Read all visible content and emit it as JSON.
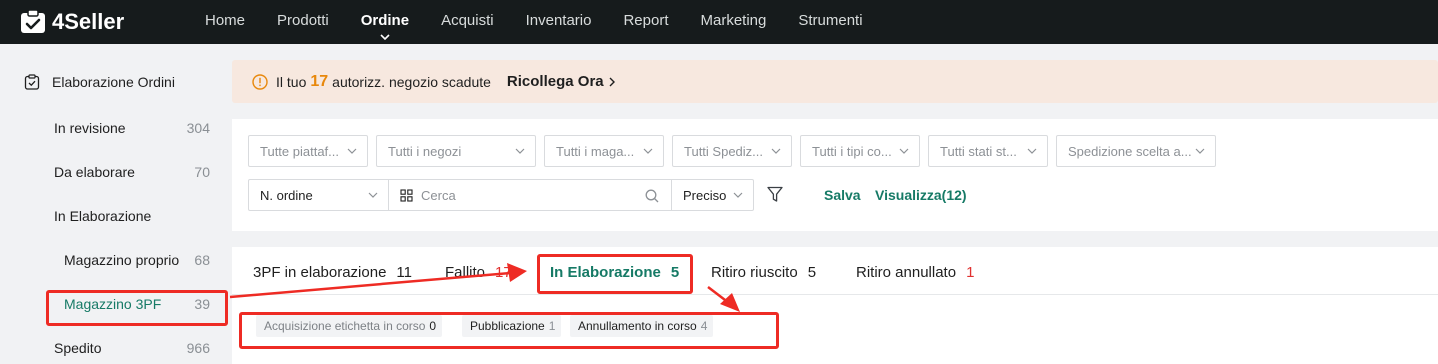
{
  "app": {
    "name": "4Seller"
  },
  "nav": {
    "items": [
      {
        "label": "Home",
        "active": false
      },
      {
        "label": "Prodotti",
        "active": false
      },
      {
        "label": "Ordine",
        "active": true
      },
      {
        "label": "Acquisti",
        "active": false
      },
      {
        "label": "Inventario",
        "active": false
      },
      {
        "label": "Report",
        "active": false
      },
      {
        "label": "Marketing",
        "active": false
      },
      {
        "label": "Strumenti",
        "active": false
      }
    ]
  },
  "sidebar": {
    "title": "Elaborazione Ordini",
    "items": [
      {
        "label": "In revisione",
        "count": "304"
      },
      {
        "label": "Da elaborare",
        "count": "70"
      },
      {
        "label": "In Elaborazione",
        "count": ""
      },
      {
        "label": "Magazzino proprio",
        "count": "68"
      },
      {
        "label": "Magazzino 3PF",
        "count": "39",
        "active": true
      },
      {
        "label": "Spedito",
        "count": "966"
      }
    ]
  },
  "banner": {
    "prefix": "Il tuo",
    "count": "17",
    "suffix": "autorizz. negozio scadute",
    "action": "Ricollega Ora"
  },
  "filters": {
    "dropdowns": [
      {
        "label": "Tutte piattaf..."
      },
      {
        "label": "Tutti i negozi"
      },
      {
        "label": "Tutti i maga..."
      },
      {
        "label": "Tutti Spediz..."
      },
      {
        "label": "Tutti i tipi co..."
      },
      {
        "label": "Tutti stati st..."
      },
      {
        "label": "Spedizione scelta a..."
      }
    ],
    "search_type": "N. ordine",
    "search_placeholder": "Cerca",
    "match_mode": "Preciso",
    "save_label": "Salva",
    "view_label": "Visualizza(12)"
  },
  "tabs": [
    {
      "label": "3PF in elaborazione",
      "count": "11"
    },
    {
      "label": "Fallito",
      "count": "17"
    },
    {
      "label": "In Elaborazione",
      "count": "5",
      "active": true
    },
    {
      "label": "Ritiro riuscito",
      "count": "5"
    },
    {
      "label": "Ritiro annullato",
      "count": "1"
    }
  ],
  "subtabs": [
    {
      "label": "Acquisizione etichetta in corso",
      "count": "0"
    },
    {
      "label": "Pubblicazione",
      "count": "1"
    },
    {
      "label": "Annullamento in corso",
      "count": "4"
    }
  ],
  "colors": {
    "accent": "#167a66",
    "annotation": "#ee2b24",
    "topbar": "#161b1c",
    "warning": "#e8880c"
  }
}
